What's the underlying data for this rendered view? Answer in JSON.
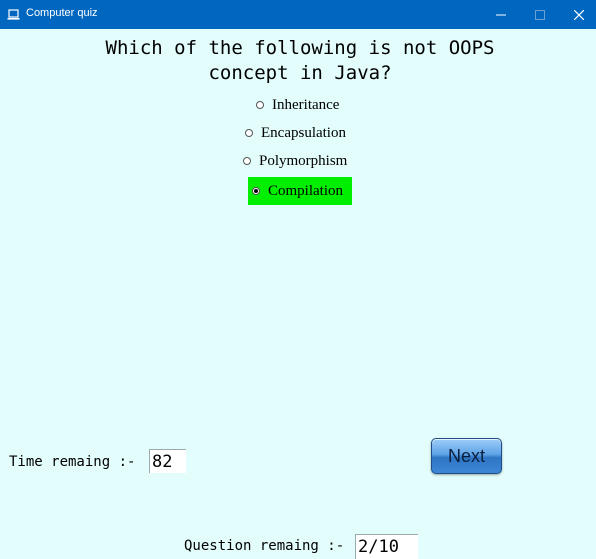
{
  "window": {
    "title": "Computer quiz",
    "controls": {
      "minimize": "—",
      "maximize": "☐",
      "close": "✕"
    }
  },
  "question": {
    "line1": "Which of the following is not OOPS",
    "line2": "concept in Java?"
  },
  "options": [
    {
      "label": "Inheritance",
      "selected": false
    },
    {
      "label": "Encapsulation",
      "selected": false
    },
    {
      "label": "Polymorphism",
      "selected": false
    },
    {
      "label": "Compilation",
      "selected": true
    }
  ],
  "timer": {
    "label": "Time remaing :-",
    "value": "82"
  },
  "progress": {
    "label": "Question remaing :-",
    "value": "2/10"
  },
  "next_button": {
    "label": "Next"
  },
  "colors": {
    "titlebar": "#0067c0",
    "background": "#e2fdfc",
    "selected_option": "#00ee00"
  },
  "icons": {
    "app": "laptop-icon"
  }
}
